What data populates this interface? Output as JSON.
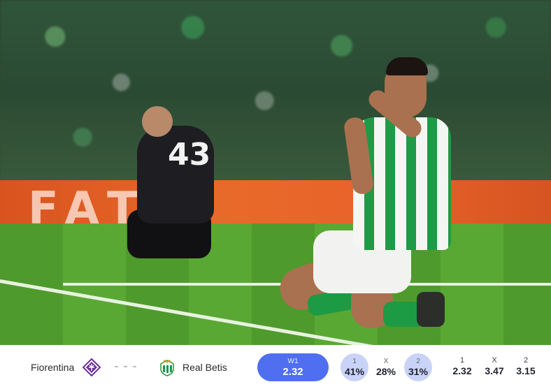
{
  "match": {
    "home_team": "Fiorentina",
    "away_team": "Real Betis",
    "home_crest": "fiorentina-crest-icon",
    "away_crest": "real-betis-crest-icon"
  },
  "selected_bet": {
    "label": "W1",
    "value": "2.32",
    "color": "#4f6ff0"
  },
  "probabilities": [
    {
      "label": "1",
      "value": "41%"
    },
    {
      "label": "X",
      "value": "28%"
    },
    {
      "label": "2",
      "value": "31%"
    }
  ],
  "odds": [
    {
      "label": "1",
      "value": "2.32"
    },
    {
      "label": "X",
      "value": "3.47"
    },
    {
      "label": "2",
      "value": "3.15"
    }
  ],
  "photo": {
    "goalkeeper_number": "43",
    "board_text": "FAT"
  },
  "colors": {
    "accent": "#4f6ff0",
    "probability_bg": "#c9d3f7",
    "fiorentina": "#6b2d9e",
    "betis": "#1d9a44"
  }
}
